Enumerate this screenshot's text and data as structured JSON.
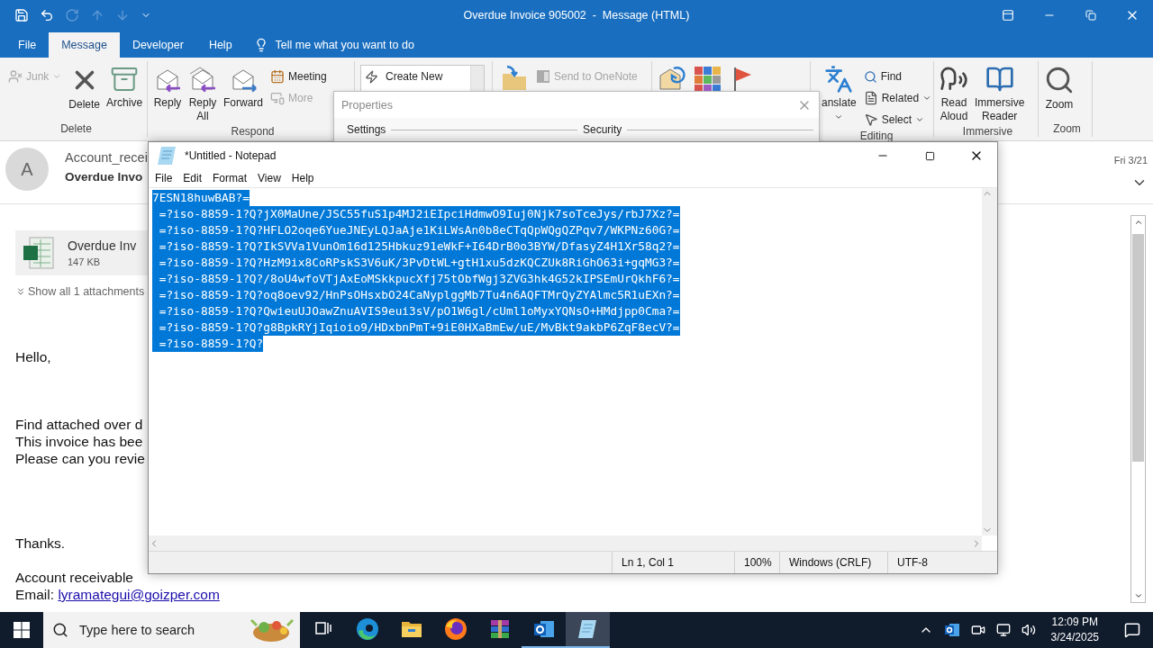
{
  "window": {
    "title": "Overdue Invoice 905002  -  Message (HTML)"
  },
  "quick_access": [
    {
      "kind": "save",
      "disabled": false
    },
    {
      "kind": "undo",
      "disabled": false
    },
    {
      "kind": "redo",
      "disabled": true
    },
    {
      "kind": "up",
      "disabled": true
    },
    {
      "kind": "down",
      "disabled": true
    },
    {
      "kind": "customize",
      "disabled": false
    }
  ],
  "menu_tabs": [
    {
      "label": "File",
      "selected": false
    },
    {
      "label": "Message",
      "selected": true
    },
    {
      "label": "Developer",
      "selected": false
    },
    {
      "label": "Help",
      "selected": false
    }
  ],
  "tell_me": {
    "placeholder": "Tell me what you want to do"
  },
  "ribbon": [
    {
      "label": "Delete",
      "items": [
        {
          "kind": "junk",
          "label": "Junk",
          "disabled": true,
          "dropdown": true
        },
        {
          "kind": "delete",
          "label": "Delete",
          "disabled": false,
          "dropdown": false
        },
        {
          "kind": "archive",
          "label": "Archive",
          "disabled": false,
          "dropdown": false
        }
      ]
    },
    {
      "label": "Respond",
      "items": [
        {
          "kind": "reply",
          "label": "Reply",
          "disabled": false,
          "dropdown": false
        },
        {
          "kind": "reply-all",
          "label": "Reply All",
          "disabled": false,
          "dropdown": false
        },
        {
          "kind": "forward",
          "label": "Forward",
          "disabled": false,
          "dropdown": false
        },
        {
          "kind": "meeting",
          "label": "Meeting",
          "disabled": false,
          "dropdown": false
        },
        {
          "kind": "more",
          "label": "More",
          "disabled": true,
          "dropdown": false
        }
      ]
    },
    {
      "items": [
        {
          "kind": "create-new",
          "label": "Create New",
          "disabled": false,
          "dropdown": false
        }
      ]
    },
    {
      "items": [
        {
          "kind": "move",
          "disabled": false,
          "dropdown": false
        },
        {
          "kind": "onenote",
          "label": "Send to OneNote",
          "disabled": true,
          "dropdown": false
        }
      ]
    },
    {
      "items": [
        {
          "kind": "rules",
          "disabled": false,
          "dropdown": false
        },
        {
          "kind": "categorize",
          "disabled": false,
          "dropdown": false
        },
        {
          "kind": "flag",
          "disabled": false,
          "dropdown": false
        }
      ]
    },
    {
      "label": "Editing",
      "items": [
        {
          "kind": "translate",
          "label": "anslate",
          "disabled": false,
          "dropdown": true
        },
        {
          "kind": "find",
          "label": "Find",
          "disabled": false,
          "dropdown": false
        },
        {
          "kind": "related",
          "label": "Related",
          "disabled": false,
          "dropdown": true
        },
        {
          "kind": "select",
          "label": "Select",
          "disabled": false,
          "dropdown": true
        }
      ]
    },
    {
      "label": "Immersive",
      "items": [
        {
          "kind": "read-aloud",
          "label": "Read Aloud",
          "disabled": false,
          "dropdown": false
        },
        {
          "kind": "immersive-reader",
          "label": "Immersive Reader",
          "disabled": false,
          "dropdown": false
        }
      ]
    },
    {
      "label": "Zoom",
      "items": [
        {
          "kind": "zoom",
          "label": "Zoom",
          "disabled": false,
          "dropdown": false
        }
      ]
    }
  ],
  "properties_dialog": {
    "title": "Properties",
    "sections": [
      "Settings",
      "Security"
    ]
  },
  "message": {
    "avatar": "A",
    "sender": "Account_recei",
    "subject": "Overdue Invo",
    "date": "Fri 3/21",
    "attachment": {
      "name": "Overdue Inv",
      "size": "147 KB"
    },
    "show_all": "Show all 1 attachments",
    "paragraphs": [
      [
        "Hello,"
      ],
      [
        "Find attached over d",
        "This invoice has bee",
        "Please can you revie"
      ],
      [
        "Thanks."
      ],
      [
        "Account receivable"
      ]
    ],
    "email": {
      "label": "Email:",
      "link": "lyramategui@goizper.com"
    }
  },
  "notepad": {
    "title": "*Untitled - Notepad",
    "menu": [
      "File",
      "Edit",
      "Format",
      "View",
      "Help"
    ],
    "selected": true,
    "lines": [
      "7ESN18huwBAB?=",
      " =?iso-8859-1?Q?jX0MaUne/JSC55fuS1p4MJ2iEIpciHdmwO9Iuj0Njk7soTceJys/rbJ7Xz?=",
      " =?iso-8859-1?Q?HFLO2oqe6YueJNEyLQJaAje1KiLWsAn0b8eCTqQpWQgQZPqv7/WKPNz60G?=",
      " =?iso-8859-1?Q?IkSVVa1VunOm16d125Hbkuz91eWkF+I64DrB0o3BYW/DfasyZ4H1Xr58q2?=",
      " =?iso-8859-1?Q?HzM9ix8CoRPskS3V6uK/3PvDtWL+gtH1xu5dzKQCZUk8RiGhO63i+gqMG3?=",
      " =?iso-8859-1?Q?/8oU4wfoVTjAxEoMSkkpucXfj75tObfWgj3ZVG3hk4G52kIPSEmUrQkhF6?=",
      " =?iso-8859-1?Q?oq8oev92/HnPsOHsxbO24CaNyplggMb7Tu4n6AQFTMrQyZYAlmc5R1uEXn?=",
      " =?iso-8859-1?Q?QwieuUJOawZnuAVIS9eui3sV/pO1W6gl/cUml1oMyxYQNsO+HMdjpp0Cma?=",
      " =?iso-8859-1?Q?g8BpkRYjIqioio9/HDxbnPmT+9iE0HXaBmEw/uE/MvBkt9akbP6ZqF8ecV?=",
      " =?iso-8859-1?Q?"
    ],
    "status": {
      "position": "Ln 1, Col 1",
      "zoom": "100%",
      "line_ending": "Windows (CRLF)",
      "encoding": "UTF-8"
    }
  },
  "taskbar": {
    "search": {
      "placeholder": "Type here to search"
    },
    "apps": [
      {
        "kind": "task-view",
        "active": false,
        "running": false
      },
      {
        "kind": "edge",
        "active": false,
        "running": false
      },
      {
        "kind": "explorer",
        "active": false,
        "running": false
      },
      {
        "kind": "firefox",
        "active": false,
        "running": false
      },
      {
        "kind": "winrar",
        "active": false,
        "running": false
      },
      {
        "kind": "outlook",
        "active": false,
        "running": true
      },
      {
        "kind": "notepad",
        "active": true,
        "running": true
      }
    ],
    "clock": {
      "time": "12:09 PM",
      "date": "3/24/2025"
    }
  }
}
